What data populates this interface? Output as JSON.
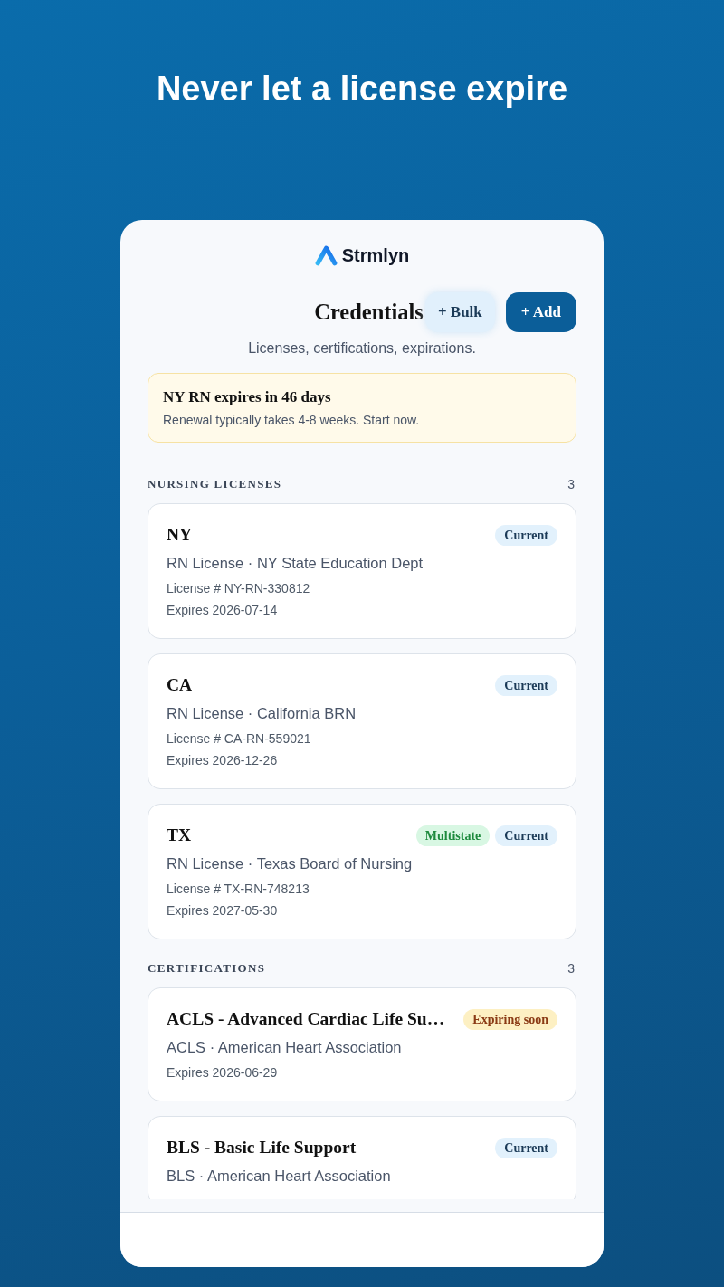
{
  "headline": "Never let a license expire",
  "app": {
    "logo_text": "Strmlyn"
  },
  "header": {
    "title": "Credentials",
    "buttons": [
      {
        "label": "+ Bulk",
        "kind": "secondary"
      },
      {
        "label": "+ Add",
        "kind": "primary"
      }
    ],
    "subtitle": "Licenses, certifications, expirations."
  },
  "alert": {
    "title": "NY RN expires in 46 days",
    "text": "Renewal typically takes 4-8 weeks. Start now."
  },
  "sections": [
    {
      "title": "NURSING LICENSES",
      "count": "3",
      "items": [
        {
          "title": "NY",
          "badges": [
            {
              "label": "Current",
              "kind": "current"
            }
          ],
          "subtitle": "RN License · NY State Education Dept",
          "details": [
            "License # NY-RN-330812",
            "Expires 2026-07-14"
          ]
        },
        {
          "title": "CA",
          "badges": [
            {
              "label": "Current",
              "kind": "current"
            }
          ],
          "subtitle": "RN License · California BRN",
          "details": [
            "License # CA-RN-559021",
            "Expires 2026-12-26"
          ]
        },
        {
          "title": "TX",
          "badges": [
            {
              "label": "Multistate",
              "kind": "multistate"
            },
            {
              "label": "Current",
              "kind": "current"
            }
          ],
          "subtitle": "RN License · Texas Board of Nursing",
          "details": [
            "License # TX-RN-748213",
            "Expires 2027-05-30"
          ]
        }
      ]
    },
    {
      "title": "CERTIFICATIONS",
      "count": "3",
      "items": [
        {
          "title": "ACLS - Advanced Cardiac Life Su…",
          "badges": [
            {
              "label": "Expiring soon",
              "kind": "expiring"
            }
          ],
          "subtitle": "ACLS · American Heart Association",
          "details": [
            "Expires 2026-06-29"
          ]
        },
        {
          "title": "BLS - Basic Life Support",
          "badges": [
            {
              "label": "Current",
              "kind": "current"
            }
          ],
          "subtitle": "BLS · American Heart Association"
        }
      ]
    }
  ]
}
